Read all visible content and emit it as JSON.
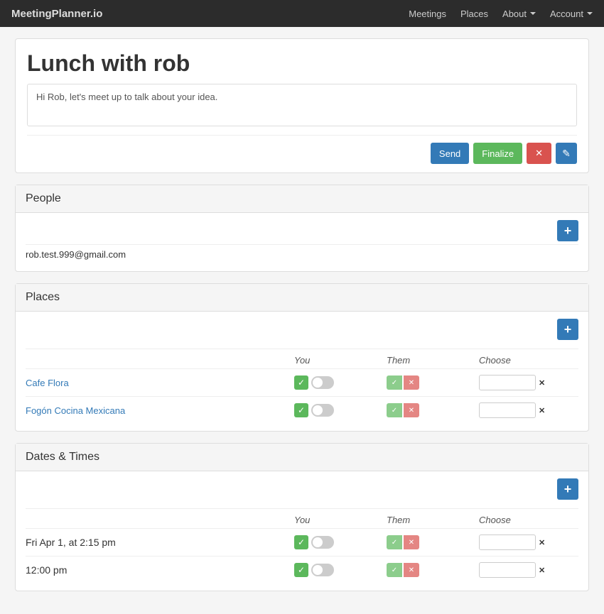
{
  "navbar": {
    "brand": "MeetingPlanner.io",
    "links": [
      {
        "label": "Meetings",
        "dropdown": false
      },
      {
        "label": "Places",
        "dropdown": false
      },
      {
        "label": "About",
        "dropdown": true
      },
      {
        "label": "Account",
        "dropdown": true
      }
    ]
  },
  "meeting": {
    "title": "Lunch with rob",
    "description": "Hi Rob, let's meet up to talk about your idea.",
    "actions": {
      "send": "Send",
      "finalize": "Finalize",
      "delete_icon": "✕",
      "edit_icon": "✎"
    }
  },
  "people": {
    "section_title": "People",
    "add_icon": "+",
    "email": "rob.test.999@gmail.com"
  },
  "places": {
    "section_title": "Places",
    "add_icon": "+",
    "columns": {
      "you": "You",
      "them": "Them",
      "choose": "Choose"
    },
    "rows": [
      {
        "name": "Cafe Flora"
      },
      {
        "name": "Fogón Cocina Mexicana"
      }
    ]
  },
  "dates": {
    "section_title": "Dates & Times",
    "add_icon": "+",
    "columns": {
      "you": "You",
      "them": "Them",
      "choose": "Choose"
    },
    "rows": [
      {
        "name": "Fri Apr 1, at 2:15 pm"
      },
      {
        "name": "12:00 pm"
      }
    ]
  }
}
